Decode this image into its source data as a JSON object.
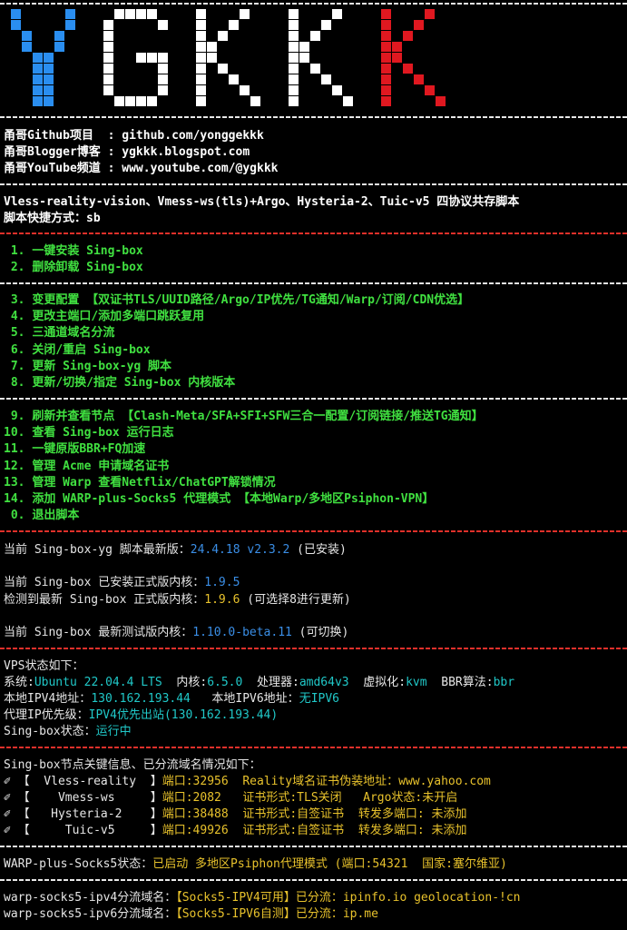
{
  "banner": {
    "logo_text": "YGKKK",
    "colors": [
      "#2a8ef0",
      "#ffffff",
      "#ffffff",
      "#ffffff",
      "#e01820"
    ]
  },
  "links": [
    {
      "label": "甬哥Github项目  ",
      "value": "github.com/yonggekkk"
    },
    {
      "label": "甬哥Blogger博客 ",
      "value": "ygkkk.blogspot.com"
    },
    {
      "label": "甬哥YouTube频道 ",
      "value": "www.youtube.com/@ygkkk"
    }
  ],
  "intro": {
    "line1": "Vless-reality-vision、Vmess-ws(tls)+Argo、Hysteria-2、Tuic-v5 四协议共存脚本",
    "line2": "脚本快捷方式：sb"
  },
  "menu": [
    {
      "num": " 1.",
      "label": "一键安装 Sing-box"
    },
    {
      "num": " 2.",
      "label": "删除卸载 Sing-box"
    },
    {
      "num": " 3.",
      "label": "变更配置 【双证书TLS/UUID路径/Argo/IP优先/TG通知/Warp/订阅/CDN优选】"
    },
    {
      "num": " 4.",
      "label": "更改主端口/添加多端口跳跃复用"
    },
    {
      "num": " 5.",
      "label": "三通道域名分流"
    },
    {
      "num": " 6.",
      "label": "关闭/重启 Sing-box"
    },
    {
      "num": " 7.",
      "label": "更新 Sing-box-yg 脚本"
    },
    {
      "num": " 8.",
      "label": "更新/切换/指定 Sing-box 内核版本"
    },
    {
      "num": " 9.",
      "label": "刷新并查看节点 【Clash-Meta/SFA+SFI+SFW三合一配置/订阅链接/推送TG通知】"
    },
    {
      "num": "10.",
      "label": "查看 Sing-box 运行日志"
    },
    {
      "num": "11.",
      "label": "一键原版BBR+FQ加速"
    },
    {
      "num": "12.",
      "label": "管理 Acme 申请域名证书"
    },
    {
      "num": "13.",
      "label": "管理 Warp 查看Netflix/ChatGPT解锁情况"
    },
    {
      "num": "14.",
      "label": "添加 WARP-plus-Socks5 代理模式 【本地Warp/多地区Psiphon-VPN】"
    },
    {
      "num": " 0.",
      "label": "退出脚本"
    }
  ],
  "versions": {
    "script_label": "当前 Sing-box-yg 脚本最新版：",
    "script_value": "24.4.18 v2.3.2",
    "script_note": " (已安装)",
    "installed_label": "当前 Sing-box 已安装正式版内核：",
    "installed_value": "1.9.5",
    "latest_label": "检测到最新 Sing-box 正式版内核：",
    "latest_value": "1.9.6",
    "latest_note": " (可选择8进行更新)",
    "beta_label": "当前 Sing-box 最新测试版内核：",
    "beta_value": "1.10.0-beta.11",
    "beta_note": " (可切换)"
  },
  "vps": {
    "title": "VPS状态如下：",
    "system_label": "系统:",
    "system_value": "Ubuntu 22.04.4 LTS",
    "kernel_label": "  内核:",
    "kernel_value": "6.5.0",
    "cpu_label": "  处理器:",
    "cpu_value": "amd64v3",
    "virt_label": "  虚拟化:",
    "virt_value": "kvm",
    "bbr_label": "  BBR算法:",
    "bbr_value": "bbr",
    "ipv4_label": "本地IPV4地址：",
    "ipv4_value": "130.162.193.44",
    "ipv6_label": "   本地IPV6地址：",
    "ipv6_value": "无IPV6",
    "proxy_label": "代理IP优先级：",
    "proxy_value": "IPV4优先出站(130.162.193.44)",
    "status_label": "Sing-box状态：",
    "status_value": "运行中"
  },
  "nodes": {
    "title": "Sing-box节点关键信息、已分流域名情况如下：",
    "items": [
      {
        "name": "【  Vless-reality  】",
        "port": "端口:32956",
        "detail": "  Reality域名证书伪装地址：www.yahoo.com"
      },
      {
        "name": "【    Vmess-ws     】",
        "port": "端口:2082 ",
        "detail": "  证书形式:TLS关闭   Argo状态:未开启"
      },
      {
        "name": "【   Hysteria-2    】",
        "port": "端口:38488",
        "detail": "  证书形式:自签证书  转发多端口: 未添加"
      },
      {
        "name": "【     Tuic-v5     】",
        "port": "端口:49926",
        "detail": "  证书形式:自签证书  转发多端口: 未添加"
      }
    ]
  },
  "warp": {
    "label": "WARP-plus-Socks5状态：",
    "value": "已启动 多地区Psiphon代理模式 (端口:54321  国家:塞尔维亚)"
  },
  "routing": [
    {
      "label": "warp-socks5-ipv4分流域名：",
      "value": "【Socks5-IPV4可用】已分流：ipinfo.io geolocation-!cn"
    },
    {
      "label": "warp-socks5-ipv6分流域名：",
      "value": "【Socks5-IPV6自测】已分流：ip.me"
    }
  ]
}
